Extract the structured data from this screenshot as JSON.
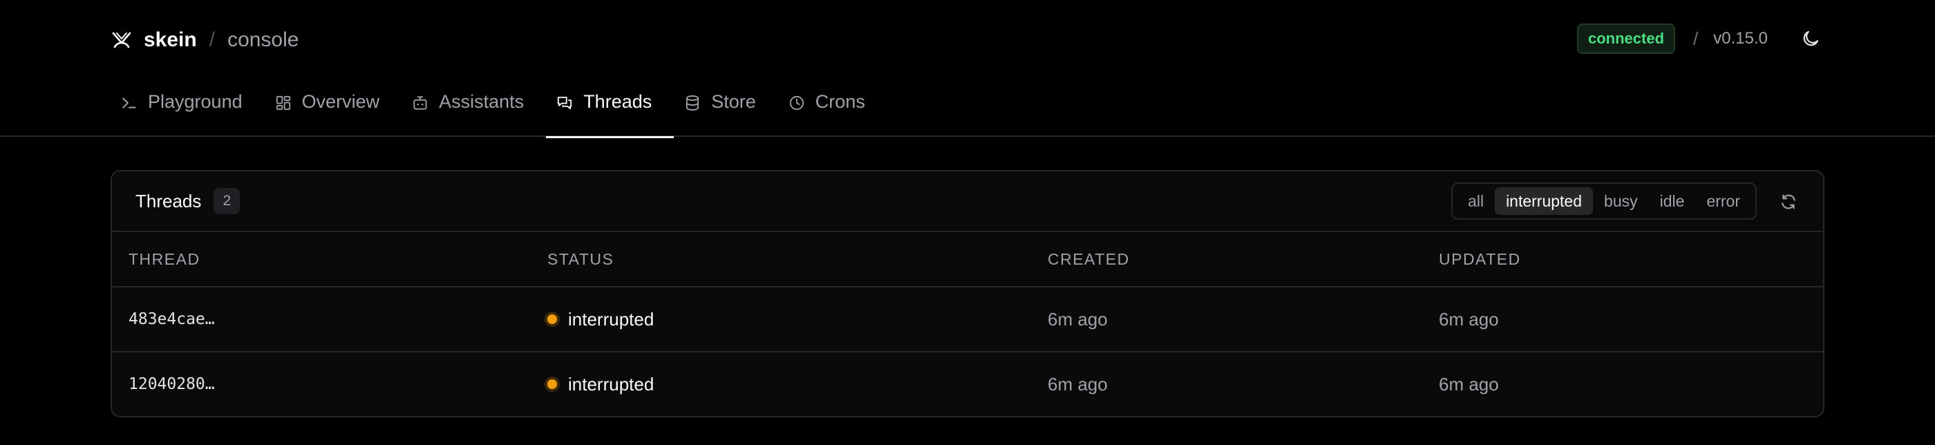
{
  "header": {
    "brand_name": "skein",
    "brand_separator": "/",
    "brand_sub": "console",
    "status_badge": "connected",
    "version_separator": "/",
    "version": "v0.15.0"
  },
  "nav": {
    "tabs": [
      {
        "label": "Playground",
        "icon": "terminal-icon"
      },
      {
        "label": "Overview",
        "icon": "dashboard-icon"
      },
      {
        "label": "Assistants",
        "icon": "bot-icon"
      },
      {
        "label": "Threads",
        "icon": "chat-bubbles-icon",
        "active": true
      },
      {
        "label": "Store",
        "icon": "database-icon"
      },
      {
        "label": "Crons",
        "icon": "clock-icon"
      }
    ]
  },
  "threads_panel": {
    "title": "Threads",
    "count": "2",
    "filters": [
      "all",
      "interrupted",
      "busy",
      "idle",
      "error"
    ],
    "active_filter": "interrupted",
    "columns": [
      "THREAD",
      "STATUS",
      "CREATED",
      "UPDATED"
    ],
    "rows": [
      {
        "thread": "483e4cae…",
        "status": "interrupted",
        "created": "6m ago",
        "updated": "6m ago"
      },
      {
        "thread": "12040280…",
        "status": "interrupted",
        "created": "6m ago",
        "updated": "6m ago"
      }
    ]
  },
  "colors": {
    "background": "#000000",
    "accent_green": "#4ade80",
    "status_interrupted": "#f59e0b"
  }
}
